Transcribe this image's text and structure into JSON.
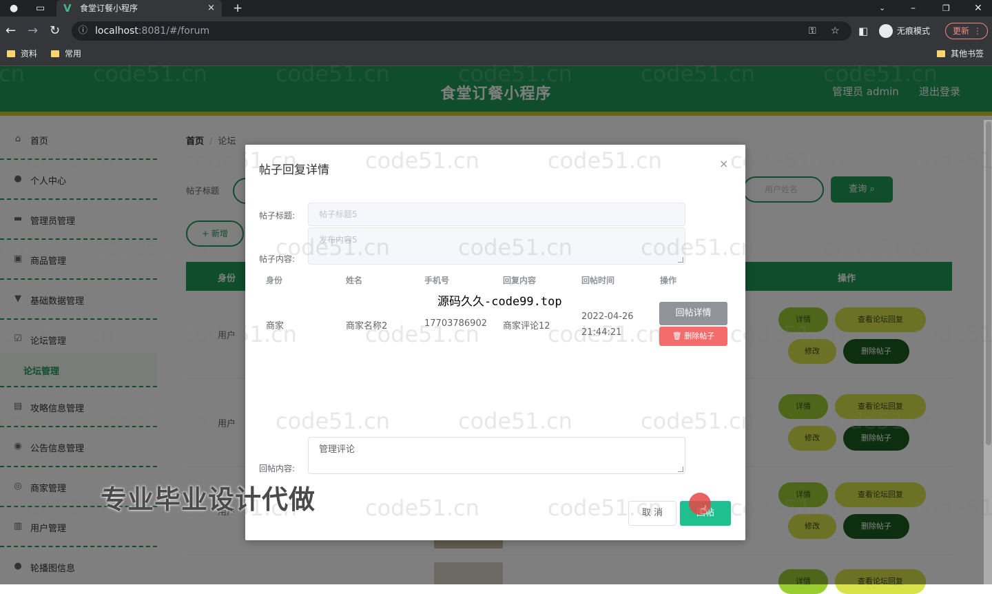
{
  "browser": {
    "tab_title": "食堂订餐小程序",
    "tab_close": "×",
    "new_tab": "+",
    "url_host": "localhost",
    "url_port": ":8081",
    "url_path": "/#/forum",
    "incognito_label": "无痕模式",
    "update_label": "更新",
    "bookmarks": [
      "资料",
      "常用"
    ],
    "other_bookmarks": "其他书签"
  },
  "app": {
    "title": "食堂订餐小程序",
    "user_label": "管理员 admin",
    "logout_label": "退出登录"
  },
  "sidebar": {
    "items": [
      {
        "label": "首页",
        "icon": "home-icon"
      },
      {
        "label": "个人中心",
        "icon": "user-icon"
      },
      {
        "label": "管理员管理",
        "icon": "admin-icon"
      },
      {
        "label": "商品管理",
        "icon": "goods-icon"
      },
      {
        "label": "基础数据管理",
        "icon": "data-icon"
      },
      {
        "label": "论坛管理",
        "icon": "forum-icon"
      }
    ],
    "sub_item": "论坛管理",
    "items2": [
      {
        "label": "攻略信息管理",
        "icon": "guide-icon"
      },
      {
        "label": "公告信息管理",
        "icon": "notice-icon"
      },
      {
        "label": "商家管理",
        "icon": "shop-icon"
      },
      {
        "label": "用户管理",
        "icon": "users-icon"
      },
      {
        "label": "轮播图信息",
        "icon": "carousel-icon"
      }
    ]
  },
  "main": {
    "breadcrumb_home": "首页",
    "breadcrumb_sep": "/",
    "breadcrumb_current": "论坛",
    "search_label": "帖子标题",
    "search_user_placeholder": "用户姓名",
    "search_button": "查询",
    "add_button": "+ 新增",
    "table_headers": [
      "身份",
      "操作"
    ],
    "rows": [
      {
        "who": "用户",
        "detail": "详情",
        "view": "查看论坛回复",
        "edit": "修改",
        "delete": "删除帖子"
      },
      {
        "who": "用户",
        "detail": "详情",
        "view": "查看论坛回复",
        "edit": "修改",
        "delete": "删除帖子"
      },
      {
        "who": "用户",
        "detail": "详情",
        "view": "查看论坛回复",
        "edit": "修改",
        "delete": "删除帖子"
      },
      {
        "who": "",
        "detail": "详情",
        "view": "查看论坛回复",
        "edit": "",
        "delete": ""
      }
    ]
  },
  "dialog": {
    "title": "帖子回复详情",
    "close": "×",
    "title_label": "帖子标题:",
    "title_value": "帖子标题5",
    "content_label": "帖子内容:",
    "content_value": "发布内容5",
    "columns": [
      "身份",
      "姓名",
      "手机号",
      "回复内容",
      "回帖时间",
      "操作"
    ],
    "overlay_text": "源码久久-code99.top",
    "reply_row": {
      "role": "商家",
      "name": "商家名称2",
      "phone": "17703786902",
      "content": "商家评论12",
      "time": "2022-04-26 21:44:21",
      "detail_button": "回帖详情",
      "delete_button": "删除帖子"
    },
    "reply_label": "回帖内容:",
    "reply_value": "管理评论",
    "cancel_button": "取 消",
    "submit_button": "回帖"
  },
  "watermarks": {
    "text": "code51.cn",
    "banner": "专业毕业设计代做"
  },
  "colors": {
    "primary": "#1f9a56",
    "accent_strip": "#c8cc2a",
    "submit": "#1fbf8f",
    "danger": "#f56c6c"
  }
}
